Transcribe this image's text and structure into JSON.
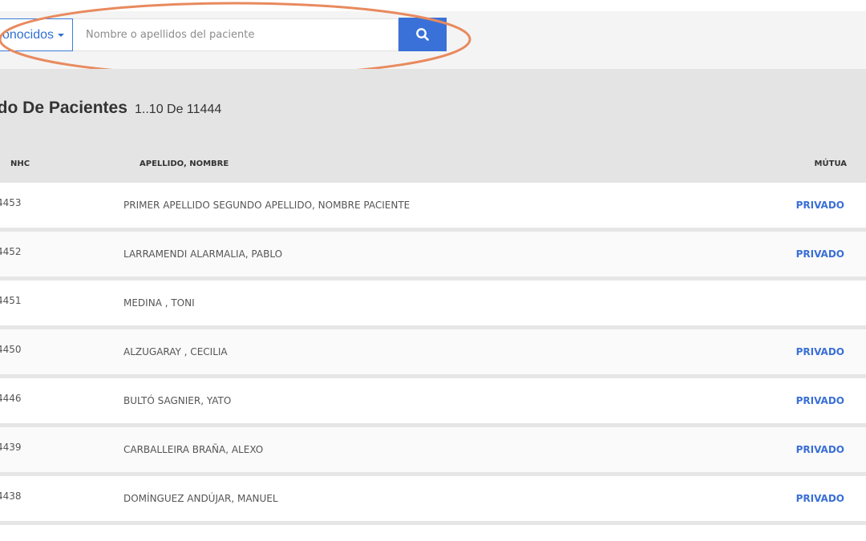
{
  "search": {
    "filter_label": "onocidos",
    "placeholder": "Nombre o apellidos del paciente"
  },
  "list": {
    "title": "tado De Pacientes",
    "range": "1..10 De 11444"
  },
  "table": {
    "headers": {
      "nhc": "NHC",
      "name": "APELLIDO, NOMBRE",
      "mutua": "MÚTUA"
    },
    "rows": [
      {
        "nhc": "4453",
        "name": "PRIMER APELLIDO SEGUNDO APELLIDO, NOMBRE PACIENTE",
        "mutua": "PRIVADO"
      },
      {
        "nhc": "4452",
        "name": "LARRAMENDI ALARMALIA, PABLO",
        "mutua": "PRIVADO"
      },
      {
        "nhc": "4451",
        "name": "MEDINA , TONI",
        "mutua": ""
      },
      {
        "nhc": "4450",
        "name": "ALZUGARAY , CECILIA",
        "mutua": "PRIVADO"
      },
      {
        "nhc": "4446",
        "name": "BULTÓ SAGNIER, YATO",
        "mutua": "PRIVADO"
      },
      {
        "nhc": "4439",
        "name": "CARBALLEIRA BRAÑA, ALEXO",
        "mutua": "PRIVADO"
      },
      {
        "nhc": "4438",
        "name": "DOMÍNGUEZ ANDÚJAR, MANUEL",
        "mutua": "PRIVADO"
      }
    ]
  },
  "colors": {
    "accent": "#3a71d9",
    "highlight": "#e88a5e",
    "link": "#3a6fd6"
  },
  "icons": {
    "search": "search-icon",
    "caret": "caret-down-icon"
  }
}
